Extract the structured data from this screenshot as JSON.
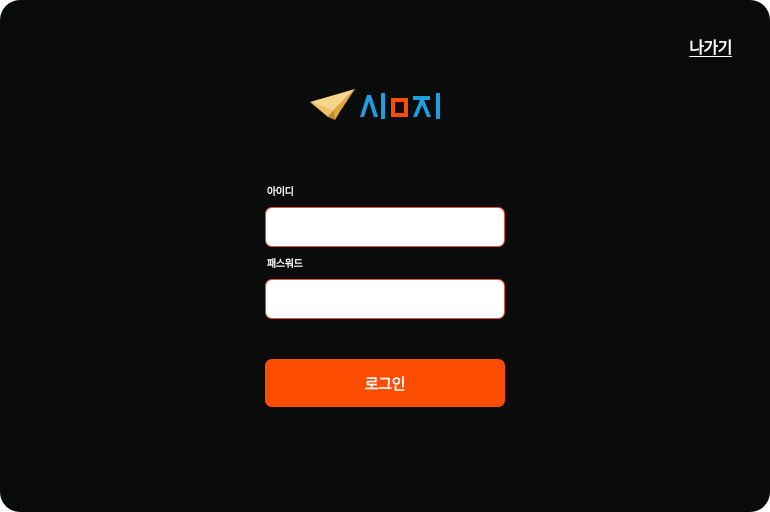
{
  "header": {
    "exit_label": "나가기"
  },
  "logo": {
    "icon": "paper-plane-icon",
    "letters": [
      "ㅅ",
      "ㅣ",
      "ㅁ",
      "ㅈ",
      "ㅣ"
    ],
    "colors": {
      "plane_light": "#f6d58a",
      "plane_dark": "#e2a63c",
      "blue": "#1e9fe0",
      "orange": "#fb4c01"
    }
  },
  "form": {
    "id_label": "아이디",
    "id_value": "",
    "id_placeholder": "",
    "password_label": "패스워드",
    "password_value": "",
    "password_placeholder": ""
  },
  "login": {
    "label": "로그인"
  },
  "colors": {
    "background": "#0a0b0b",
    "accent": "#fb4c01",
    "input_border": "#e8502a"
  }
}
